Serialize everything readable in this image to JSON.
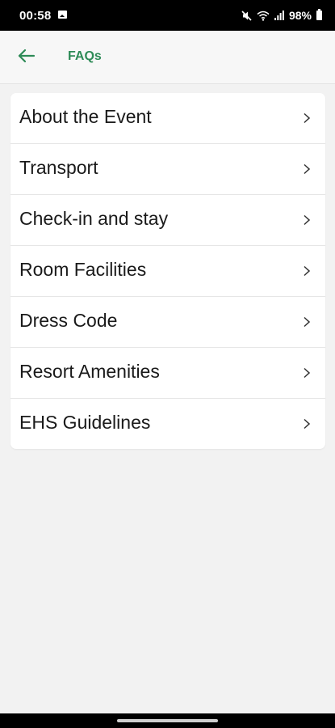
{
  "status_bar": {
    "time": "00:58",
    "battery_percent": "98%",
    "icons": [
      "image-icon",
      "mute-icon",
      "wifi-icon",
      "signal-icon",
      "battery-icon"
    ]
  },
  "header": {
    "title": "FAQs",
    "back_icon": "arrow-left-icon",
    "accent_color": "#2e8b57"
  },
  "faq_list": {
    "items": [
      {
        "label": "About the Event"
      },
      {
        "label": "Transport"
      },
      {
        "label": "Check-in and stay"
      },
      {
        "label": "Room Facilities"
      },
      {
        "label": "Dress Code"
      },
      {
        "label": "Resort Amenities"
      },
      {
        "label": "EHS Guidelines"
      }
    ],
    "chevron_icon": "chevron-right-icon"
  },
  "colors": {
    "background": "#f2f2f2",
    "card": "#ffffff",
    "text": "#1a1a1a"
  }
}
